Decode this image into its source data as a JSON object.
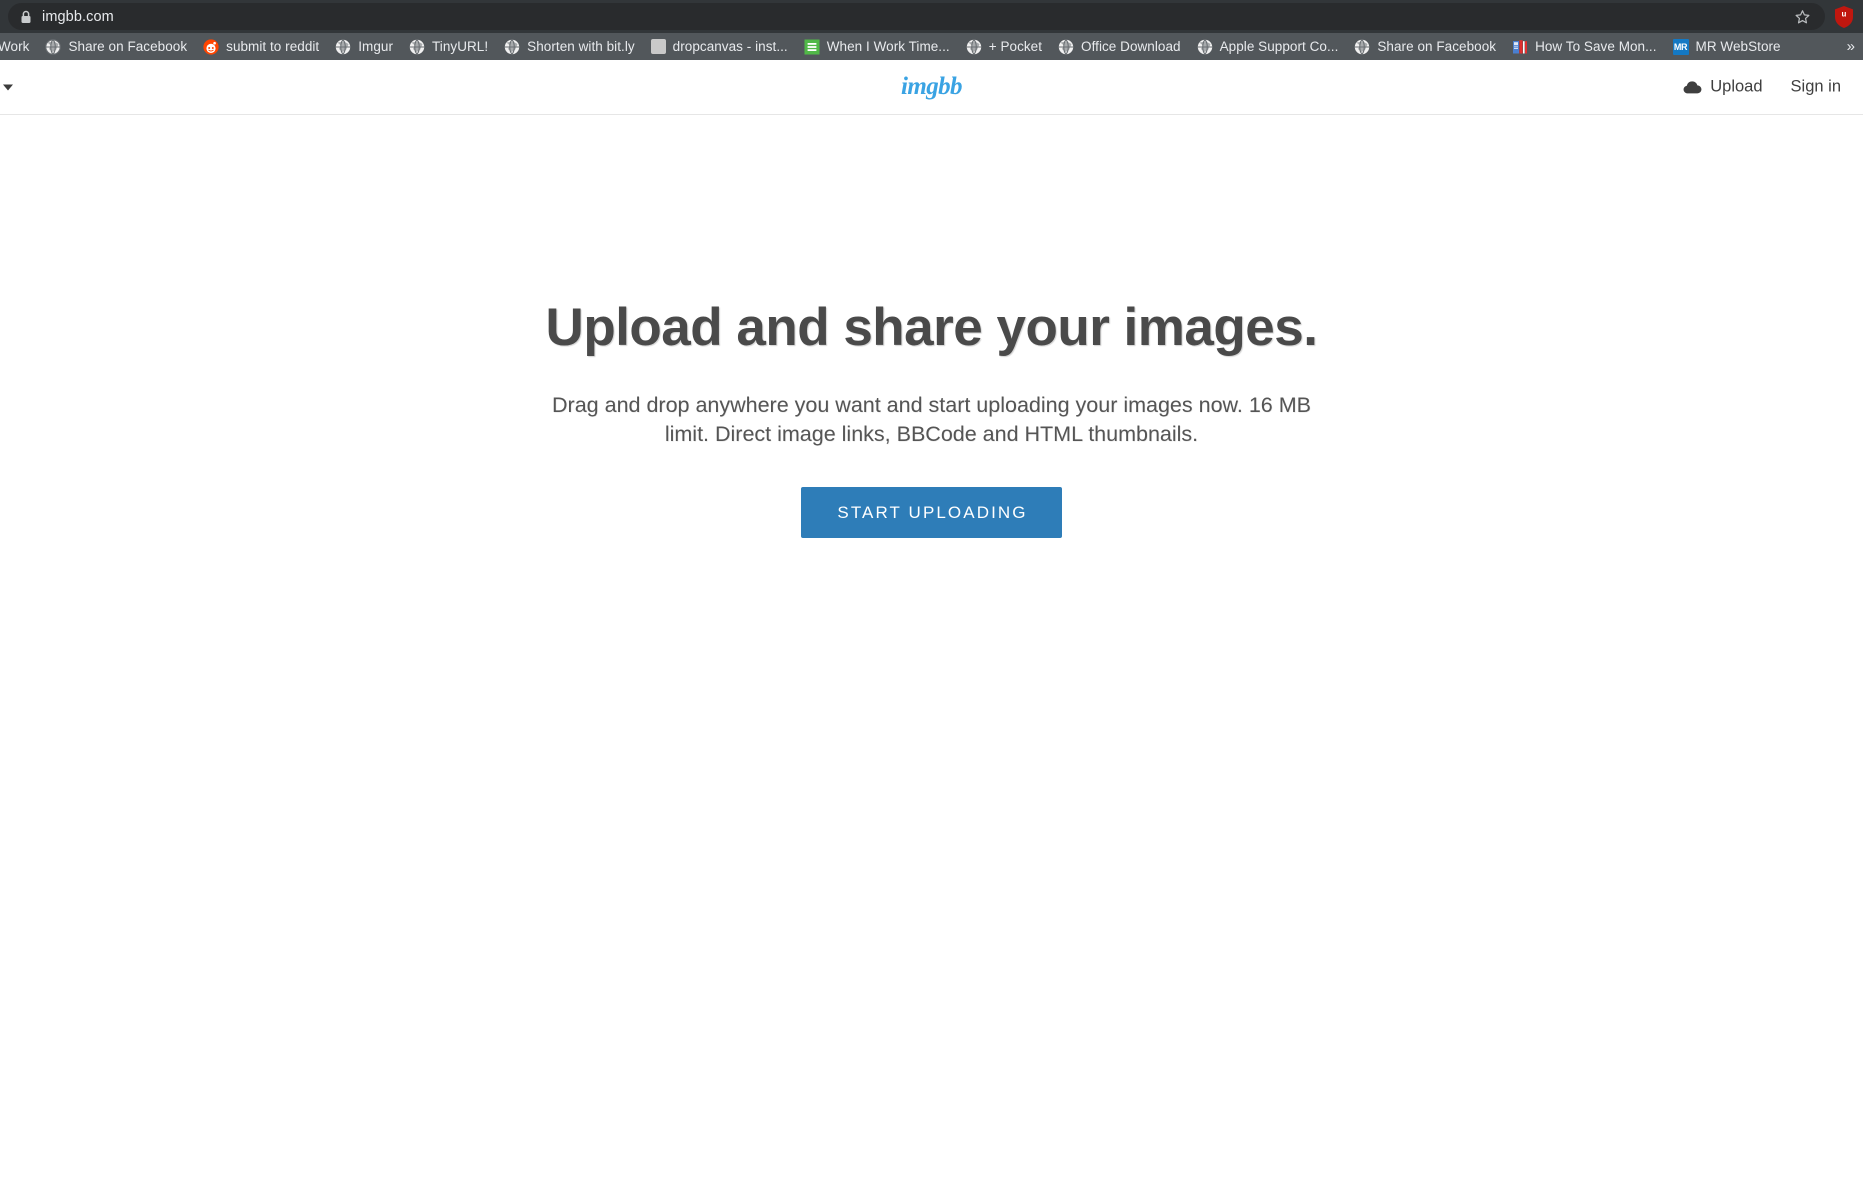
{
  "browser": {
    "omnibox": {
      "url": "imgbb.com",
      "lock_icon": "lock-icon",
      "star_icon": "star-icon"
    },
    "extension_icon": "shield-icon",
    "bookmarks": [
      {
        "label": "Work",
        "icon": "folder-icon",
        "icon_type": "none"
      },
      {
        "label": "Share on Facebook",
        "icon": "globe-icon",
        "icon_type": "globe"
      },
      {
        "label": "submit to reddit",
        "icon": "reddit-icon",
        "icon_type": "reddit"
      },
      {
        "label": "Imgur",
        "icon": "globe-icon",
        "icon_type": "globe"
      },
      {
        "label": "TinyURL!",
        "icon": "globe-icon",
        "icon_type": "globe"
      },
      {
        "label": "Shorten with bit.ly",
        "icon": "globe-icon",
        "icon_type": "globe"
      },
      {
        "label": "dropcanvas - inst...",
        "icon": "gray-square-icon",
        "icon_type": "gray-square"
      },
      {
        "label": "When I Work Time...",
        "icon": "when-i-work-icon",
        "icon_type": "green-menu"
      },
      {
        "label": "+ Pocket",
        "icon": "globe-icon",
        "icon_type": "globe"
      },
      {
        "label": "Office Download",
        "icon": "globe-icon",
        "icon_type": "globe"
      },
      {
        "label": "Apple Support Co...",
        "icon": "globe-icon",
        "icon_type": "globe"
      },
      {
        "label": "Share on Facebook",
        "icon": "globe-icon",
        "icon_type": "globe"
      },
      {
        "label": "How To Save Mon...",
        "icon": "books-icon",
        "icon_type": "books"
      },
      {
        "label": "MR WebStore",
        "icon": "mr-icon",
        "icon_type": "mr"
      }
    ],
    "bookmarks_overflow_label": "»"
  },
  "site": {
    "brand": "imgbb",
    "nav": {
      "upload_label": "Upload",
      "upload_icon": "cloud-upload-icon",
      "signin_label": "Sign in",
      "menu_caret_icon": "chevron-down-icon"
    },
    "hero": {
      "title": "Upload and share your images.",
      "subtitle": "Drag and drop anywhere you want and start uploading your images now. 16 MB limit. Direct image links, BBCode and HTML thumbnails.",
      "cta_label": "START UPLOADING"
    }
  },
  "colors": {
    "brand_blue": "#3aa3e3",
    "cta_blue": "#2e7db8",
    "chrome_dark": "#323639",
    "bookmark_bar": "#52575b",
    "heading_gray": "#4a4a4a"
  }
}
